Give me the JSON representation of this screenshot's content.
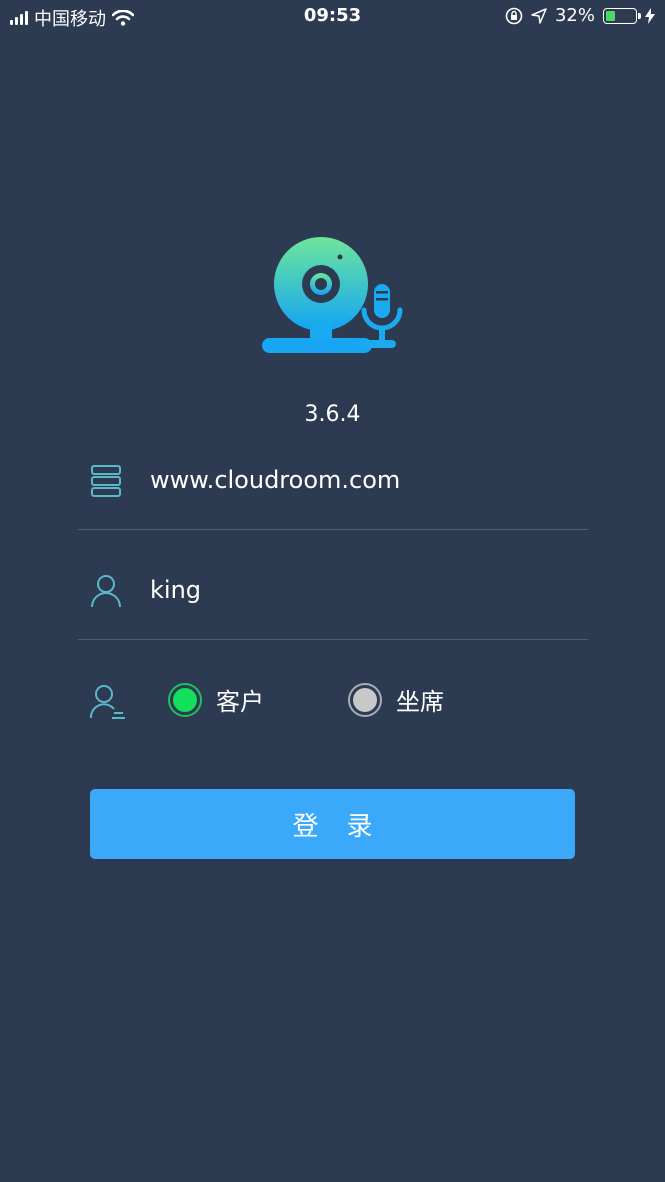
{
  "status_bar": {
    "carrier": "中国移动",
    "time": "09:53",
    "battery_percent": "32%",
    "battery_level": 0.32,
    "icons": [
      "signal-icon",
      "wifi-icon",
      "orientation-lock-icon",
      "location-icon",
      "battery-icon",
      "charging-icon"
    ]
  },
  "app": {
    "logo_icon": "webcam-microphone-logo",
    "version": "3.6.4"
  },
  "form": {
    "server": {
      "value": "www.cloudroom.com",
      "icon": "server-icon"
    },
    "username": {
      "value": "king",
      "icon": "user-icon"
    },
    "role": {
      "icon": "user-role-icon",
      "options": [
        {
          "label": "客户",
          "selected": true
        },
        {
          "label": "坐席",
          "selected": false
        }
      ]
    },
    "login_label": "登录"
  },
  "colors": {
    "background": "#2d3b52",
    "accent": "#3aa9fa",
    "selected_radio": "#12e05a",
    "icon_teal": "#5bb8c9"
  }
}
